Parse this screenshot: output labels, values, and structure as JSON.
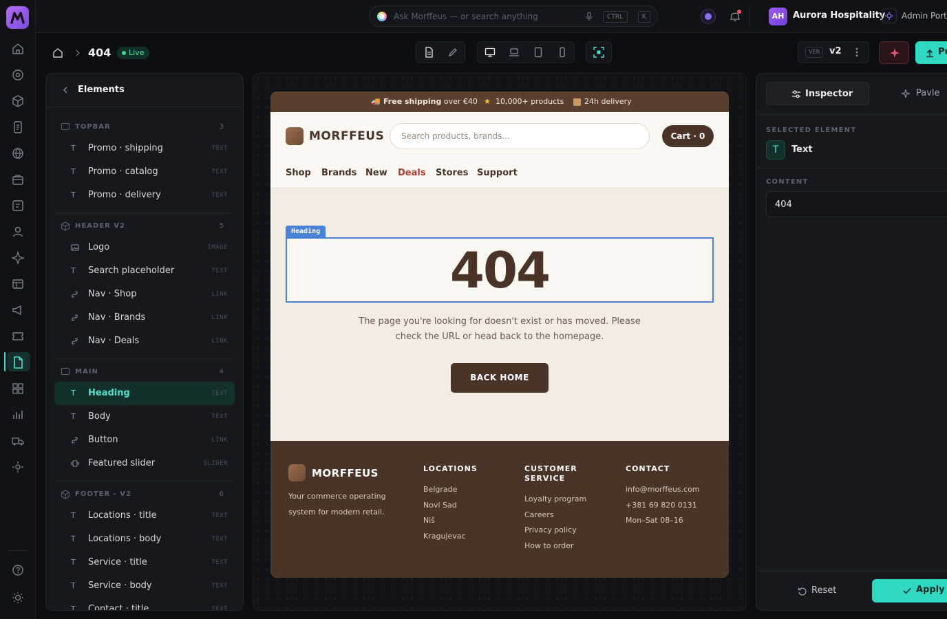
{
  "topbar": {
    "search_placeholder": "Ask Morffeus — or search anything",
    "kbd_ctrl": "CTRL",
    "kbd_k": "K",
    "org_initials": "AH",
    "org_name": "Aurora Hospitality",
    "portal": "Admin Portal"
  },
  "toolbar": {
    "page_title": "404",
    "status": "Live",
    "version_label": "VER",
    "version": "v2",
    "publish_label": "Pu"
  },
  "elements_panel": {
    "title": "Elements",
    "groups": [
      {
        "name": "TOPBAR",
        "count": "3",
        "items": [
          {
            "label": "Promo · shipping",
            "type": "TEXT"
          },
          {
            "label": "Promo · catalog",
            "type": "TEXT"
          },
          {
            "label": "Promo · delivery",
            "type": "TEXT"
          }
        ]
      },
      {
        "name": "HEADER V2",
        "count": "5",
        "items": [
          {
            "label": "Logo",
            "type": "IMAGE"
          },
          {
            "label": "Search placeholder",
            "type": "TEXT"
          },
          {
            "label": "Nav · Shop",
            "type": "LINK"
          },
          {
            "label": "Nav · Brands",
            "type": "LINK"
          },
          {
            "label": "Nav · Deals",
            "type": "LINK"
          }
        ]
      },
      {
        "name": "MAIN",
        "count": "4",
        "items": [
          {
            "label": "Heading",
            "type": "TEXT"
          },
          {
            "label": "Body",
            "type": "TEXT"
          },
          {
            "label": "Button",
            "type": "LINK"
          },
          {
            "label": "Featured slider",
            "type": "SLIDER"
          }
        ]
      },
      {
        "name": "FOOTER - V2",
        "count": "6",
        "items": [
          {
            "label": "Locations · title",
            "type": "TEXT"
          },
          {
            "label": "Locations · body",
            "type": "TEXT"
          },
          {
            "label": "Service · title",
            "type": "TEXT"
          },
          {
            "label": "Service · body",
            "type": "TEXT"
          },
          {
            "label": "Contact · title",
            "type": "TEXT"
          }
        ]
      }
    ]
  },
  "site": {
    "promo_shipping_bold": "Free shipping",
    "promo_shipping_rest": " over €40",
    "promo_catalog": "10,000+ products",
    "promo_delivery": "24h delivery",
    "brand": "MORFFEUS",
    "search_placeholder": "Search products, brands...",
    "cart": "Cart · 0",
    "nav": [
      "Shop",
      "Brands",
      "New",
      "Deals",
      "Stores",
      "Support"
    ],
    "heading_tag": "Heading",
    "heading": "404",
    "body": "The page you're looking for doesn't exist or has moved. Please check the URL or head back to the homepage.",
    "button": "BACK HOME",
    "footer": {
      "brand": "MORFFEUS",
      "tagline_1": "Your commerce operating",
      "tagline_2": "system for modern retail.",
      "locations_title": "LOCATIONS",
      "locations": [
        "Belgrade",
        "Novi Sad",
        "Niš",
        "Kragujevac"
      ],
      "service_title_1": "CUSTOMER",
      "service_title_2": "SERVICE",
      "service": [
        "Loyalty program",
        "Careers",
        "Privacy policy",
        "How to order"
      ],
      "contact_title": "CONTACT",
      "contact": [
        "info@morffeus.com",
        "+381 69 820 0131",
        "Mon–Sat 08–16"
      ]
    }
  },
  "inspector": {
    "tab_inspector": "Inspector",
    "tab_other": "Pavle",
    "selected_label": "SELECTED ELEMENT",
    "selected_type": "Text",
    "content_label": "CONTENT",
    "content_value": "404",
    "reset": "Reset",
    "apply": "Apply"
  },
  "colors": {
    "accent": "#4fe0cc",
    "brown": "#4a3428",
    "select_blue": "#4a82d8",
    "deals_red": "#b23a2e"
  }
}
